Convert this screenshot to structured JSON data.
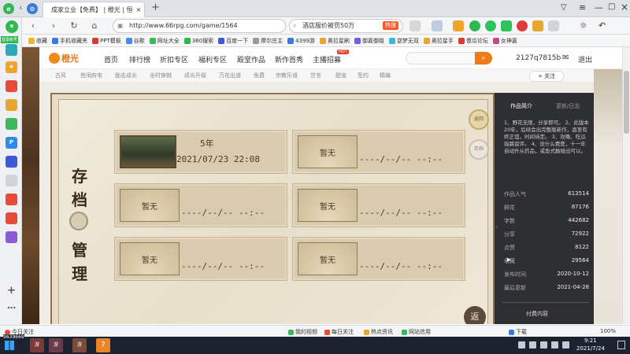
{
  "browser": {
    "tab_title": "成家立业【免费】 | 橙光 | 恒",
    "url": "http://www.66rpg.com/game/1564",
    "search_text": "酒店服价被罚50万",
    "search_hint": "热搜"
  },
  "bookmarks": [
    "收藏",
    "手机收藏夹",
    "PPT模板",
    "谷歌",
    "网址大全",
    "360搜索",
    "百度一下",
    "摩尔庄主",
    "4399游",
    "奥拉星刷",
    "御嘉御姐",
    "逆梦无双",
    "奥拉星手",
    "傻瓜论坛",
    "女神嘉"
  ],
  "sidebar": {
    "login_label": "登录帐号"
  },
  "site": {
    "logo": "橙光",
    "nav": [
      "首页",
      "排行榜",
      "折扣专区",
      "福利专区",
      "殿堂作品",
      "新作首秀",
      "主播招募"
    ],
    "nav_badge": "HOT",
    "user_id": "2127q7815b",
    "logout": "退出",
    "subnav": [
      "古风",
      "宫闱府宅",
      "励志成长",
      "全时穿越",
      "成长升级",
      "万花出道",
      "免费",
      "宗教乐道",
      "甘言",
      "甜宠",
      "签约",
      "精编"
    ],
    "follow": "+ 关注"
  },
  "game": {
    "title_top": "存档",
    "title_bottom": "管理",
    "slot1_age": "5年",
    "slot1_date": "2021/07/23 22:08",
    "empty_label": "暂无",
    "empty_date": "----/--/-- --:--",
    "side_btn1": "返回",
    "side_btn2": "存档",
    "back_btn": "返"
  },
  "panel": {
    "tab_intro": "作品简介",
    "tab_update": "更新/日志",
    "intro_text": "1、野花无限，分享即可。 2、此版本20年，后续会出完整版新作，直至有终正谊，时间待定。 3、攻略、吃瓜指路留评。 4、没什么费度，十一年自动升从药品，或鱼式触碰出可以。",
    "stats": [
      {
        "label": "作品人气",
        "value": "613514"
      },
      {
        "label": "鲜花",
        "value": "87176"
      },
      {
        "label": "字数",
        "value": "442682"
      },
      {
        "label": "分享",
        "value": "72922"
      },
      {
        "label": "点赞",
        "value": "8122"
      },
      {
        "label": "收藏",
        "value": "29564"
      },
      {
        "label": "发布时间",
        "value": "2020-10-12"
      },
      {
        "label": "最后更新",
        "value": "2021-04-28"
      }
    ],
    "footer": "付费内容"
  },
  "statusbar": {
    "left_text": "今日关注",
    "items": [
      "我的视频",
      "每日关注",
      "热点资讯",
      "网站信用"
    ],
    "download": "下载",
    "zoom": "100%"
  },
  "taskbar": {
    "counter": "9639669",
    "time": "9:21",
    "date": "2021/7/24"
  }
}
